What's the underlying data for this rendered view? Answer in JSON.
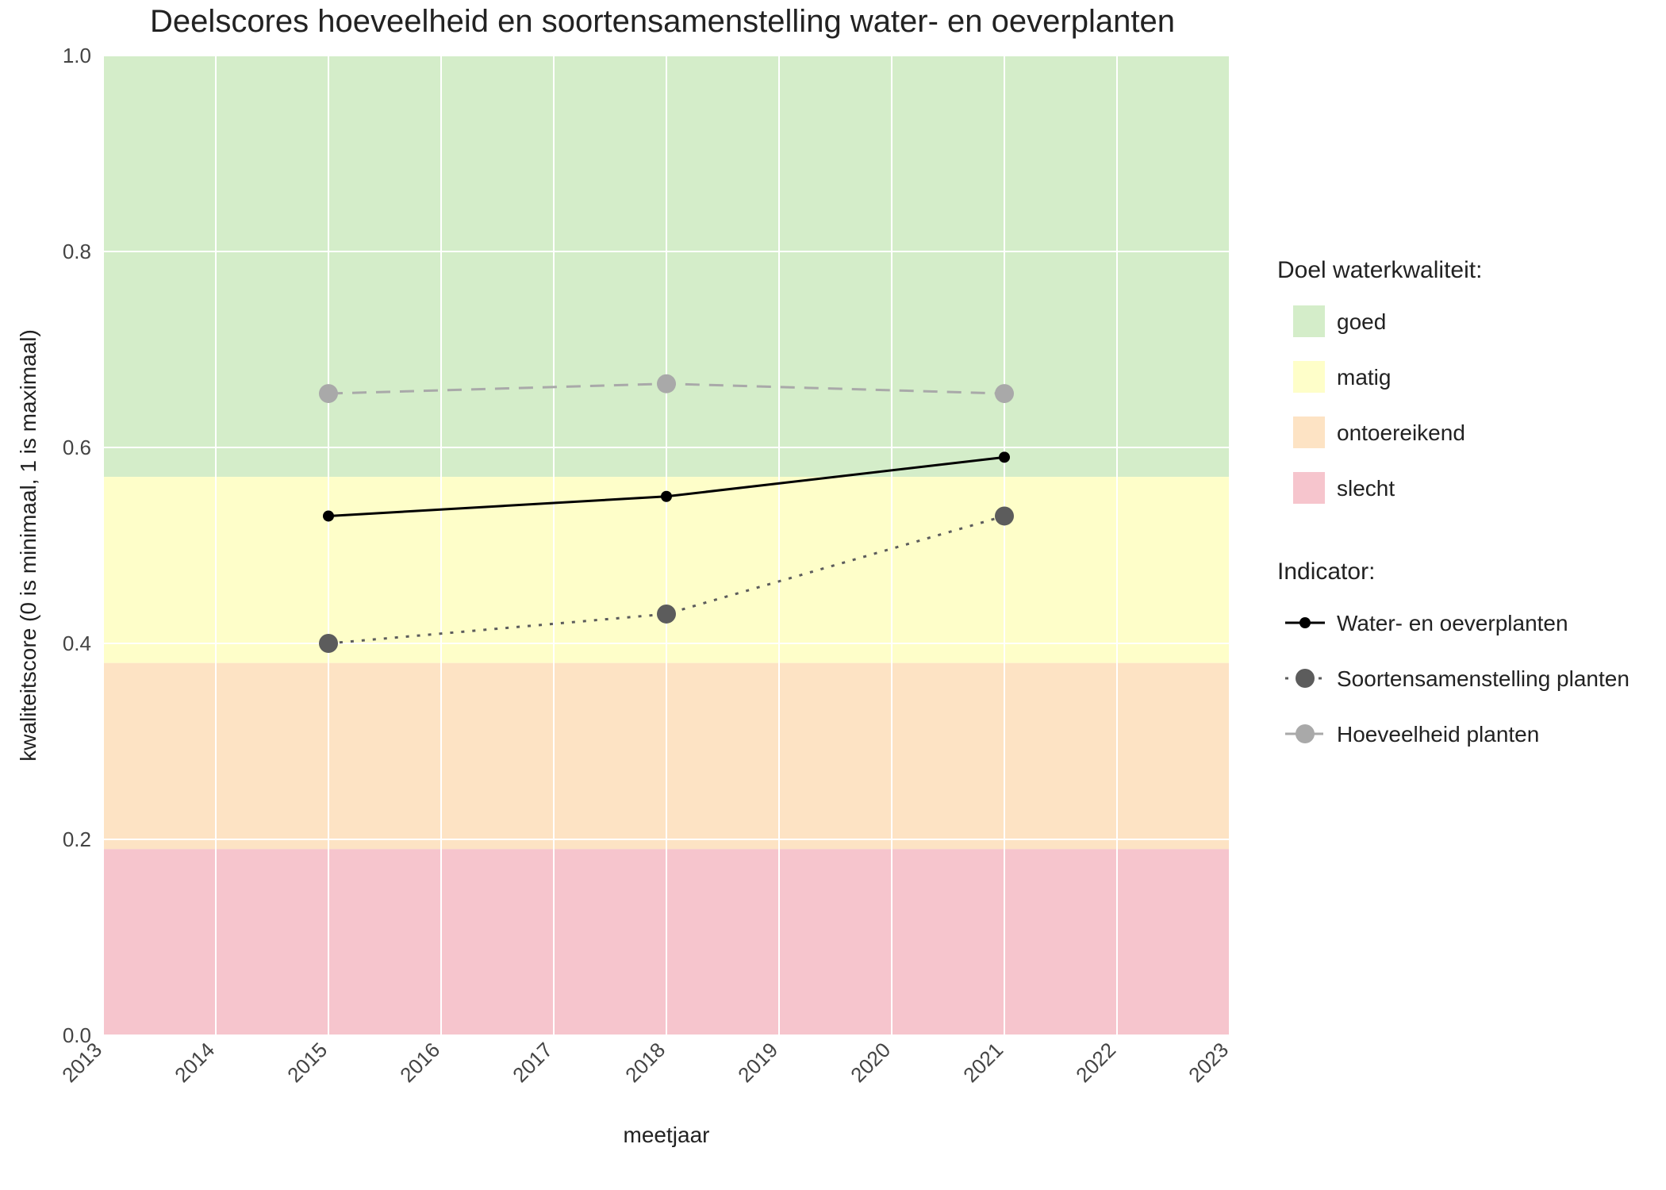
{
  "chart_data": {
    "type": "line",
    "title": "Deelscores hoeveelheid en soortensamenstelling water- en oeverplanten",
    "xlabel": "meetjaar",
    "ylabel": "kwaliteitscore (0 is minimaal, 1 is maximaal)",
    "xlim": [
      2013,
      2023
    ],
    "ylim": [
      0.0,
      1.0
    ],
    "x_ticks": [
      2013,
      2014,
      2015,
      2016,
      2017,
      2018,
      2019,
      2020,
      2021,
      2022,
      2023
    ],
    "y_ticks": [
      0.0,
      0.2,
      0.4,
      0.6,
      0.8,
      1.0
    ],
    "bands": [
      {
        "name": "goed",
        "ymin": 0.57,
        "ymax": 1.0,
        "color": "#d4edc9"
      },
      {
        "name": "matig",
        "ymin": 0.38,
        "ymax": 0.57,
        "color": "#fefec9"
      },
      {
        "name": "ontoereikend",
        "ymin": 0.19,
        "ymax": 0.38,
        "color": "#fde3c4"
      },
      {
        "name": "slecht",
        "ymin": 0.0,
        "ymax": 0.19,
        "color": "#f6c5cd"
      }
    ],
    "series": [
      {
        "name": "Water- en oeverplanten",
        "color": "#000000",
        "point_color": "#000000",
        "dash": "solid",
        "x": [
          2015,
          2018,
          2021
        ],
        "y": [
          0.53,
          0.55,
          0.59
        ]
      },
      {
        "name": "Soortensamenstelling planten",
        "color": "#5c5c5c",
        "point_color": "#5c5c5c",
        "dash": "dotted",
        "x": [
          2015,
          2018,
          2021
        ],
        "y": [
          0.4,
          0.43,
          0.53
        ]
      },
      {
        "name": "Hoeveelheid planten",
        "color": "#a9a9a9",
        "point_color": "#a9a9a9",
        "dash": "dashed",
        "x": [
          2015,
          2018,
          2021
        ],
        "y": [
          0.655,
          0.665,
          0.655
        ]
      }
    ],
    "legend1_title": "Doel waterkwaliteit:",
    "legend1_items": [
      "goed",
      "matig",
      "ontoereikend",
      "slecht"
    ],
    "legend2_title": "Indicator:",
    "legend2_items": [
      "Water- en oeverplanten",
      "Soortensamenstelling planten",
      "Hoeveelheid planten"
    ]
  }
}
